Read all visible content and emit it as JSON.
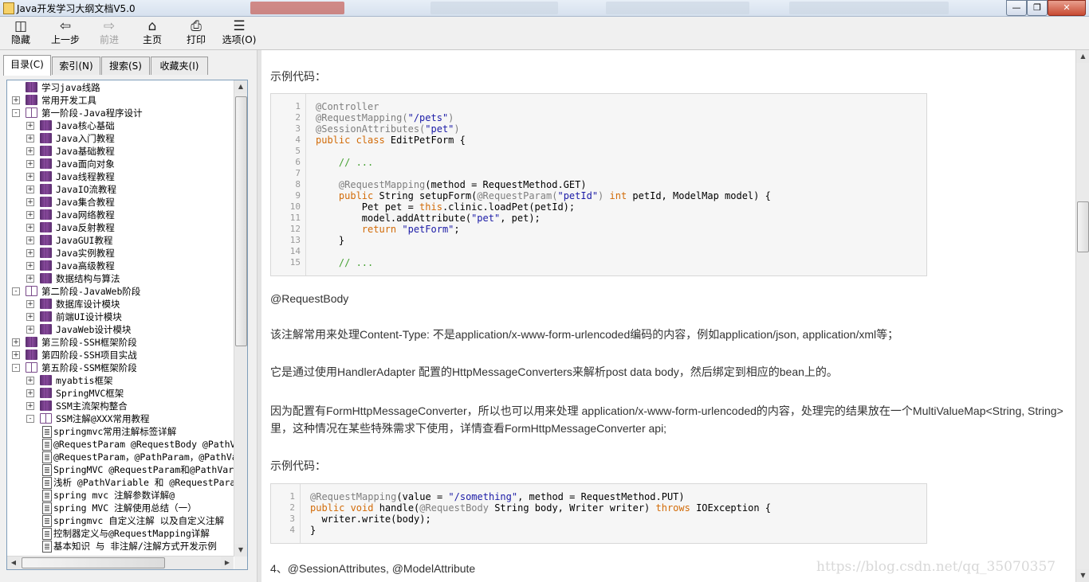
{
  "window": {
    "title": "Java开发学习大纲文档V5.0"
  },
  "toolbar": {
    "buttons": [
      {
        "label": "隐藏",
        "icon": "hide-icon"
      },
      {
        "label": "上一步",
        "icon": "back-arrow-icon"
      },
      {
        "label": "前进",
        "icon": "forward-arrow-icon",
        "disabled": true
      },
      {
        "label": "主页",
        "icon": "home-icon"
      },
      {
        "label": "打印",
        "icon": "printer-icon"
      },
      {
        "label": "选项(O)",
        "icon": "options-icon"
      }
    ]
  },
  "nav_tabs": [
    {
      "label": "目录(C)",
      "active": true
    },
    {
      "label": "索引(N)"
    },
    {
      "label": "搜索(S)"
    },
    {
      "label": "收藏夹(I)"
    }
  ],
  "tree": [
    {
      "label": "学习java线路",
      "level": 0,
      "icon": "book",
      "expander": "none"
    },
    {
      "label": "常用开发工具",
      "level": 0,
      "icon": "book",
      "expander": "+"
    },
    {
      "label": "第一阶段-Java程序设计",
      "level": 0,
      "icon": "open-book",
      "expander": "-"
    },
    {
      "label": "Java核心基础",
      "level": 1,
      "icon": "book",
      "expander": "+"
    },
    {
      "label": "Java入门教程",
      "level": 1,
      "icon": "book",
      "expander": "+"
    },
    {
      "label": "Java基础教程",
      "level": 1,
      "icon": "book",
      "expander": "+"
    },
    {
      "label": "Java面向对象",
      "level": 1,
      "icon": "book",
      "expander": "+"
    },
    {
      "label": "Java线程教程",
      "level": 1,
      "icon": "book",
      "expander": "+"
    },
    {
      "label": "JavaIO流教程",
      "level": 1,
      "icon": "book",
      "expander": "+"
    },
    {
      "label": "Java集合教程",
      "level": 1,
      "icon": "book",
      "expander": "+"
    },
    {
      "label": "Java网络教程",
      "level": 1,
      "icon": "book",
      "expander": "+"
    },
    {
      "label": "Java反射教程",
      "level": 1,
      "icon": "book",
      "expander": "+"
    },
    {
      "label": "JavaGUI教程",
      "level": 1,
      "icon": "book",
      "expander": "+"
    },
    {
      "label": "Java实例教程",
      "level": 1,
      "icon": "book",
      "expander": "+"
    },
    {
      "label": "Java高级教程",
      "level": 1,
      "icon": "book",
      "expander": "+"
    },
    {
      "label": "数据结构与算法",
      "level": 1,
      "icon": "book",
      "expander": "+"
    },
    {
      "label": "第二阶段-JavaWeb阶段",
      "level": 0,
      "icon": "open-book",
      "expander": "-"
    },
    {
      "label": "数据库设计模块",
      "level": 1,
      "icon": "book",
      "expander": "+"
    },
    {
      "label": "前端UI设计模块",
      "level": 1,
      "icon": "book",
      "expander": "+"
    },
    {
      "label": "JavaWeb设计模块",
      "level": 1,
      "icon": "book",
      "expander": "+"
    },
    {
      "label": "第三阶段-SSH框架阶段",
      "level": 0,
      "icon": "book",
      "expander": "+"
    },
    {
      "label": "第四阶段-SSH项目实战",
      "level": 0,
      "icon": "book",
      "expander": "+"
    },
    {
      "label": "第五阶段-SSM框架阶段",
      "level": 0,
      "icon": "open-book",
      "expander": "-"
    },
    {
      "label": "myabtis框架",
      "level": 1,
      "icon": "book",
      "expander": "+"
    },
    {
      "label": "SpringMVC框架",
      "level": 1,
      "icon": "book",
      "expander": "+"
    },
    {
      "label": "SSM主流架构整合",
      "level": 1,
      "icon": "book",
      "expander": "+"
    },
    {
      "label": "SSM注解@XXX常用教程",
      "level": 1,
      "icon": "open-book",
      "expander": "-"
    },
    {
      "label": "springmvc常用注解标签详解",
      "level": 2,
      "icon": "page",
      "expander": "none"
    },
    {
      "label": "@RequestParam @RequestBody @PathVa",
      "level": 2,
      "icon": "page",
      "expander": "none"
    },
    {
      "label": "@RequestParam，@PathParam，@PathVa",
      "level": 2,
      "icon": "page",
      "expander": "none"
    },
    {
      "label": "SpringMVC @RequestParam和@PathVari",
      "level": 2,
      "icon": "page",
      "expander": "none"
    },
    {
      "label": "浅析 @PathVariable 和 @RequestPara",
      "level": 2,
      "icon": "page",
      "expander": "none"
    },
    {
      "label": "spring mvc 注解参数详解@",
      "level": 2,
      "icon": "page",
      "expander": "none"
    },
    {
      "label": "spring MVC 注解使用总结（一）",
      "level": 2,
      "icon": "page",
      "expander": "none"
    },
    {
      "label": "springmvc 自定义注解 以及自定义注解",
      "level": 2,
      "icon": "page",
      "expander": "none"
    },
    {
      "label": "控制器定义与@RequestMapping详解",
      "level": 2,
      "icon": "page",
      "expander": "none"
    },
    {
      "label": "基本知识 与 非注解/注解方式开发示例",
      "level": 2,
      "icon": "page",
      "expander": "none"
    }
  ],
  "content": {
    "example_label_1": "示例代码：",
    "code1": [
      [
        [
          "a",
          "@Controller"
        ]
      ],
      [
        [
          "a",
          "@RequestMapping("
        ],
        [
          "s",
          "\"/pets\""
        ],
        [
          "a",
          ")"
        ]
      ],
      [
        [
          "a",
          "@SessionAttributes("
        ],
        [
          "s",
          "\"pet\""
        ],
        [
          "a",
          ")"
        ]
      ],
      [
        [
          "k",
          "public class "
        ],
        [
          "t",
          "EditPetForm {"
        ]
      ],
      [],
      [
        [
          "t",
          "    "
        ],
        [
          "c",
          "// ..."
        ]
      ],
      [],
      [
        [
          "t",
          "    "
        ],
        [
          "a",
          "@RequestMapping"
        ],
        [
          "t",
          "(method = RequestMethod.GET)"
        ]
      ],
      [
        [
          "t",
          "    "
        ],
        [
          "k",
          "public "
        ],
        [
          "t",
          "String setupForm("
        ],
        [
          "a",
          "@RequestParam("
        ],
        [
          "s",
          "\"petId\""
        ],
        [
          "a",
          ")"
        ],
        [
          "t",
          " "
        ],
        [
          "k",
          "int"
        ],
        [
          "t",
          " petId, ModelMap model) {"
        ]
      ],
      [
        [
          "t",
          "        Pet pet = "
        ],
        [
          "k",
          "this"
        ],
        [
          "t",
          ".clinic.loadPet(petId);"
        ]
      ],
      [
        [
          "t",
          "        model.addAttribute("
        ],
        [
          "s",
          "\"pet\""
        ],
        [
          "t",
          ", pet);"
        ]
      ],
      [
        [
          "t",
          "        "
        ],
        [
          "k",
          "return "
        ],
        [
          "s",
          "\"petForm\""
        ],
        [
          "t",
          ";"
        ]
      ],
      [
        [
          "t",
          "    }"
        ]
      ],
      [],
      [
        [
          "t",
          "    "
        ],
        [
          "c",
          "// ..."
        ]
      ]
    ],
    "heading_requestbody": "@RequestBody",
    "para1": "该注解常用来处理Content-Type: 不是application/x-www-form-urlencoded编码的内容，例如application/json, application/xml等；",
    "para2": "它是通过使用HandlerAdapter 配置的HttpMessageConverters来解析post data body，然后绑定到相应的bean上的。",
    "para3_line1": "因为配置有FormHttpMessageConverter，所以也可以用来处理 application/x-www-form-urlencoded的内容，处理完的结果放在一个MultiValueMap<String, String>",
    "para3_line2": "里，这种情况在某些特殊需求下使用，详情查看FormHttpMessageConverter api;",
    "example_label_2": "示例代码：",
    "code2": [
      [
        [
          "a",
          "@RequestMapping"
        ],
        [
          "t",
          "(value = "
        ],
        [
          "s",
          "\"/something\""
        ],
        [
          "t",
          ", method = RequestMethod.PUT)"
        ]
      ],
      [
        [
          "k",
          "public void "
        ],
        [
          "t",
          "handle("
        ],
        [
          "a",
          "@RequestBody"
        ],
        [
          "t",
          " String body, Writer writer) "
        ],
        [
          "k",
          "throws"
        ],
        [
          "t",
          " IOException {"
        ]
      ],
      [
        [
          "t",
          "  writer.write(body);"
        ]
      ],
      [
        [
          "t",
          "}"
        ]
      ]
    ],
    "heading_4": "4、@SessionAttributes, @ModelAttribute"
  },
  "watermark": "https://blog.csdn.net/qq_35070357",
  "colors": {
    "keyword": "#d26b08",
    "annotation": "#7f7f7f",
    "string": "#1a1aa6",
    "comment": "#44a030",
    "book": "#6b3a80"
  }
}
